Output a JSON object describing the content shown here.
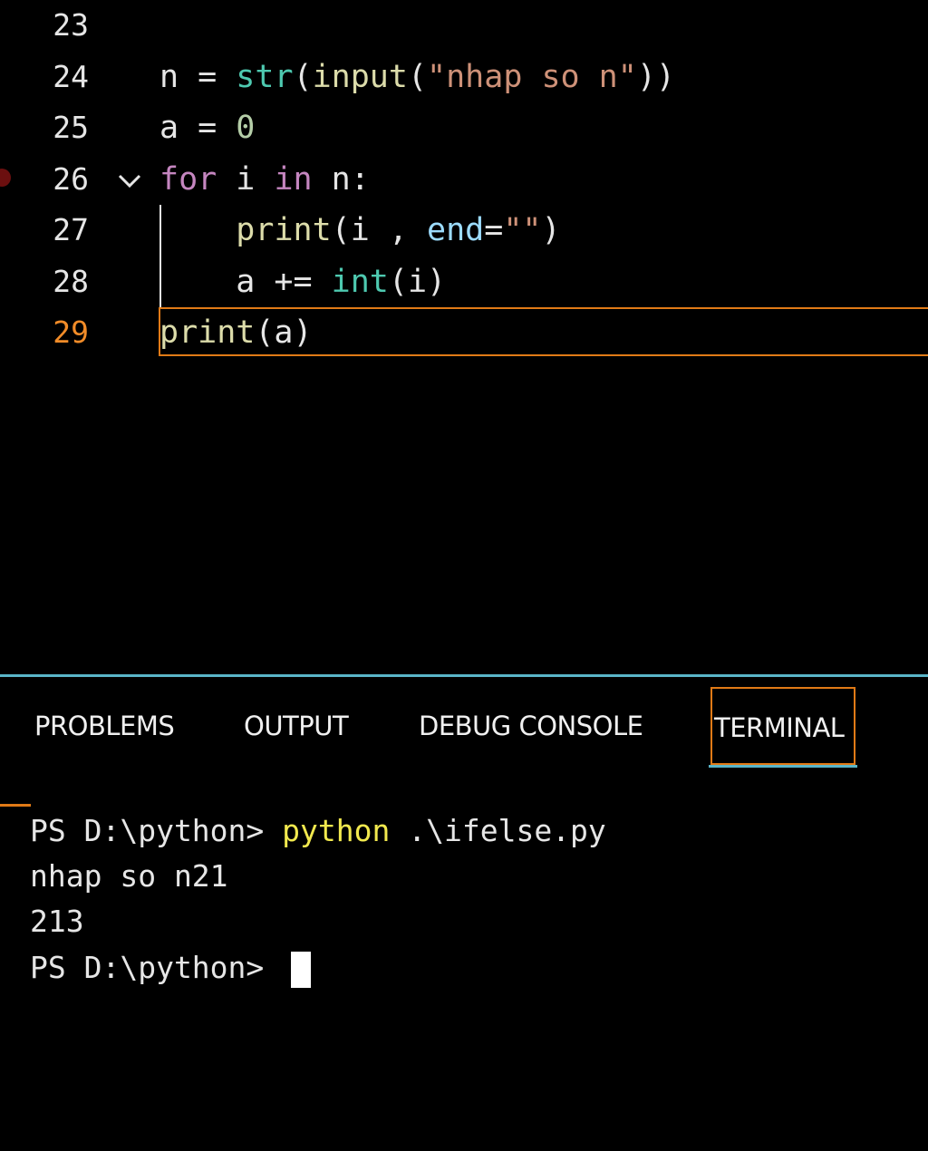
{
  "editor": {
    "lines": [
      {
        "num": "23",
        "tokens": []
      },
      {
        "num": "24",
        "tokens": [
          {
            "t": "n = ",
            "c": ""
          },
          {
            "t": "str",
            "c": "kw-builtin"
          },
          {
            "t": "(",
            "c": ""
          },
          {
            "t": "input",
            "c": "fn"
          },
          {
            "t": "(",
            "c": ""
          },
          {
            "t": "\"nhap so n\"",
            "c": "str"
          },
          {
            "t": "))",
            "c": ""
          }
        ]
      },
      {
        "num": "25",
        "tokens": [
          {
            "t": "a = ",
            "c": ""
          },
          {
            "t": "0",
            "c": "num"
          }
        ]
      },
      {
        "num": "26",
        "tokens": [
          {
            "t": "for",
            "c": "kw-ctrl"
          },
          {
            "t": " i ",
            "c": ""
          },
          {
            "t": "in",
            "c": "kw-ctrl"
          },
          {
            "t": " n:",
            "c": ""
          }
        ]
      },
      {
        "num": "27",
        "tokens": [
          {
            "t": "    ",
            "c": ""
          },
          {
            "t": "print",
            "c": "fn"
          },
          {
            "t": "(i , ",
            "c": ""
          },
          {
            "t": "end",
            "c": "param"
          },
          {
            "t": "=",
            "c": ""
          },
          {
            "t": "\"\"",
            "c": "str"
          },
          {
            "t": ")",
            "c": ""
          }
        ]
      },
      {
        "num": "28",
        "tokens": [
          {
            "t": "    a += ",
            "c": ""
          },
          {
            "t": "int",
            "c": "kw-builtin"
          },
          {
            "t": "(i)",
            "c": ""
          }
        ]
      },
      {
        "num": "29",
        "tokens": [
          {
            "t": "print",
            "c": "fn"
          },
          {
            "t": "(a)",
            "c": ""
          }
        ]
      }
    ],
    "active_line": "29",
    "breakpoint_line": "26",
    "fold_line": "26"
  },
  "panel": {
    "tabs": [
      "PROBLEMS",
      "OUTPUT",
      "DEBUG CONSOLE",
      "TERMINAL"
    ],
    "active_tab": "TERMINAL"
  },
  "terminal": {
    "prompt": "PS D:\\python> ",
    "command": "python",
    "command_args": " .\\ifelse.py",
    "output": [
      "nhap so n21",
      "213"
    ],
    "last_prompt": "PS D:\\python> "
  },
  "colors": {
    "accent_border": "#e07a16",
    "panel_separator": "#5ab5c8",
    "terminal_command": "#f2e94e"
  }
}
